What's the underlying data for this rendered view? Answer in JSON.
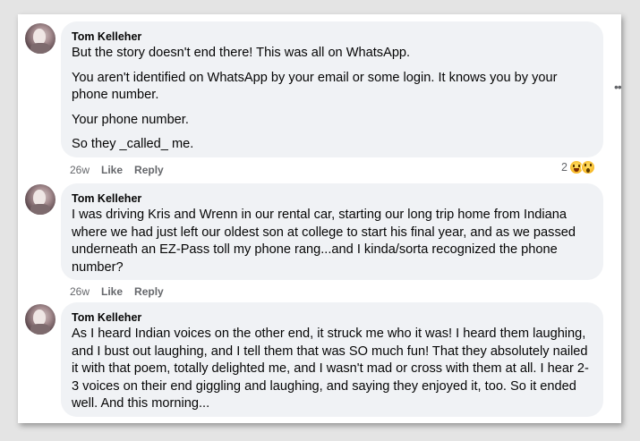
{
  "comments": [
    {
      "author": "Tom Kelleher",
      "paragraphs": [
        "But the story doesn't end there! This was all on WhatsApp.",
        "You aren't identified on WhatsApp by your email or some login. It knows you by your phone number.",
        "Your phone number.",
        "So they _called_ me."
      ],
      "time": "26w",
      "like": "Like",
      "reply": "Reply",
      "reaction_count": "2",
      "reactions": [
        "laughing-emoji",
        "wow-emoji"
      ]
    },
    {
      "author": "Tom Kelleher",
      "paragraphs": [
        "I was driving Kris and Wrenn in our rental car, starting our long trip home from Indiana where we had just left our oldest son at college to start his final year, and as we passed underneath an EZ-Pass toll my phone rang...and I kinda/sorta recognized the phone number?"
      ],
      "time": "26w",
      "like": "Like",
      "reply": "Reply"
    },
    {
      "author": "Tom Kelleher",
      "paragraphs": [
        "As I heard Indian voices on the other end, it struck me who it was! I heard them laughing, and I bust out laughing, and I tell them that was SO much fun! That they absolutely nailed it with that poem, totally delighted me, and I wasn't mad or cross with them at all. I hear 2-3 voices on their end giggling and laughing, and saying they enjoyed it, too. So it ended well. And this morning..."
      ]
    }
  ],
  "more_options_icon": "more-horizontal-icon",
  "colors": {
    "bubble": "#f0f2f5",
    "meta_text": "#65676b",
    "text": "#050505"
  }
}
